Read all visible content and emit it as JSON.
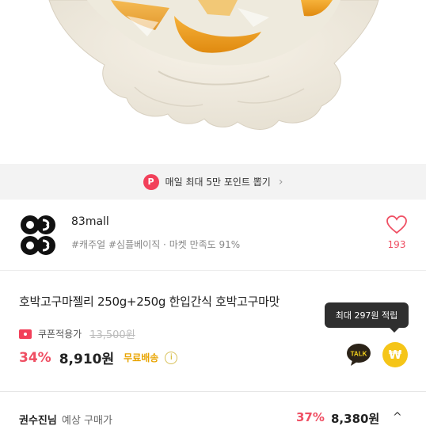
{
  "hero": {
    "image": "amber jelly candies in glass bowl"
  },
  "promo": {
    "badge": "P",
    "text": "매일 최대 5만 포인트 뽑기",
    "chevron": "›"
  },
  "seller": {
    "name": "83mall",
    "tags": "#캐주얼 #심플베이직 · 마켓 만족도 91%",
    "like_count": "193"
  },
  "product": {
    "title": "호박고구마젤리 250g+250g 한입간식 호박고구마맛",
    "coupon_label": "쿠폰적용가",
    "original_price": "13,500원",
    "discount": "34%",
    "price": "8,910원",
    "free_shipping": "무료배송",
    "info": "i",
    "tooltip": "최대 297원 적립",
    "talk_label": "TALK",
    "coin_symbol": "₩"
  },
  "expected": {
    "user_name": "권수진님",
    "label": "예상 구매가",
    "rate": "37%",
    "price": "8,380원",
    "chevron": "^"
  },
  "colors": {
    "accent": "#ef4f63",
    "promo_bg": "#f3f3f3",
    "free_ship": "#e8a400",
    "coin": "#f5c518",
    "tooltip_bg": "#2f2f2f"
  }
}
